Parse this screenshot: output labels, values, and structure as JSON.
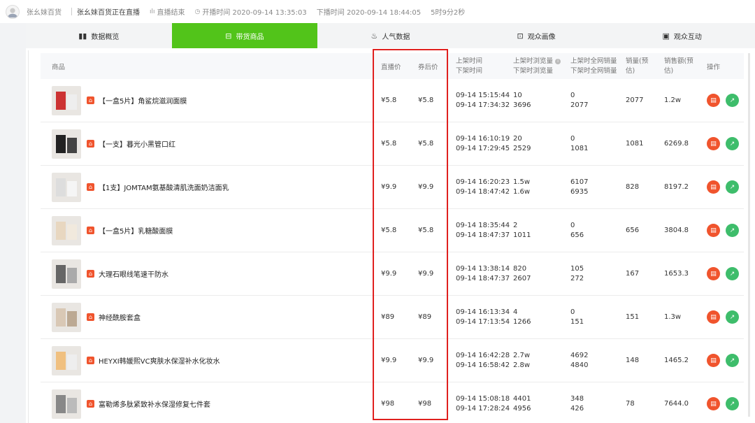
{
  "header": {
    "streamer_name": "张幺妹百货",
    "live_title": "张幺妹百货正在直播",
    "status": "直播结束",
    "start_label": "开播时间 2020-09-14 13:35:03",
    "end_label": "下播时间 2020-09-14 18:44:05",
    "duration": "5时9分2秒"
  },
  "tabs": [
    {
      "label": "数据概览",
      "icon": "bar-chart-icon"
    },
    {
      "label": "带货商品",
      "icon": "shopping-bag-icon",
      "active": true
    },
    {
      "label": "人气数据",
      "icon": "flame-icon"
    },
    {
      "label": "观众画像",
      "icon": "portrait-icon"
    },
    {
      "label": "观众互动",
      "icon": "chat-icon"
    }
  ],
  "table": {
    "headers": {
      "product": "商品",
      "live_price": "直播价",
      "coupon_price": "券后价",
      "time_on": "上架时间",
      "time_off": "下架时间",
      "views_on": "上架时浏览量",
      "views_off": "下架时浏览量",
      "sales_on": "上架时全网销量",
      "sales_off": "下架时全网销量",
      "volume_est_1": "销量(预",
      "volume_est_2": "估)",
      "amount_est_1": "销售额(预",
      "amount_est_2": "估)",
      "ops": "操作"
    },
    "rows": [
      {
        "name": "【一盒5片】角鲨烷滋润面膜",
        "live": "¥5.8",
        "coupon": "¥5.8",
        "on": "09-14 15:15:44",
        "off": "09-14 17:34:32",
        "v_on": "10",
        "v_off": "3696",
        "s_on": "0",
        "s_off": "2077",
        "vol": "2077",
        "amt": "1.2w"
      },
      {
        "name": "【一支】暮光小黑管口红",
        "live": "¥5.8",
        "coupon": "¥5.8",
        "on": "09-14 16:10:19",
        "off": "09-14 17:29:45",
        "v_on": "20",
        "v_off": "2529",
        "s_on": "0",
        "s_off": "1081",
        "vol": "1081",
        "amt": "6269.8"
      },
      {
        "name": "【1支】JOMTAM氨基酸清肌洗面奶洁面乳",
        "live": "¥9.9",
        "coupon": "¥9.9",
        "on": "09-14 16:20:23",
        "off": "09-14 18:47:42",
        "v_on": "1.5w",
        "v_off": "1.6w",
        "s_on": "6107",
        "s_off": "6935",
        "vol": "828",
        "amt": "8197.2"
      },
      {
        "name": "【一盒5片】乳糖酸面膜",
        "live": "¥5.8",
        "coupon": "¥5.8",
        "on": "09-14 18:35:44",
        "off": "09-14 18:47:37",
        "v_on": "2",
        "v_off": "1011",
        "s_on": "0",
        "s_off": "656",
        "vol": "656",
        "amt": "3804.8"
      },
      {
        "name": "大理石眼线笔速干防水",
        "live": "¥9.9",
        "coupon": "¥9.9",
        "on": "09-14 13:38:14",
        "off": "09-14 18:47:37",
        "v_on": "820",
        "v_off": "2607",
        "s_on": "105",
        "s_off": "272",
        "vol": "167",
        "amt": "1653.3"
      },
      {
        "name": "神经酰胺套盒",
        "live": "¥89",
        "coupon": "¥89",
        "on": "09-14 16:13:34",
        "off": "09-14 17:13:54",
        "v_on": "4",
        "v_off": "1266",
        "s_on": "0",
        "s_off": "151",
        "vol": "151",
        "amt": "1.3w"
      },
      {
        "name": "HEYXI韩媛熙VC爽肤水保湿补水化妆水",
        "live": "¥9.9",
        "coupon": "¥9.9",
        "on": "09-14 16:42:28",
        "off": "09-14 16:58:42",
        "v_on": "2.7w",
        "v_off": "2.8w",
        "s_on": "4692",
        "s_off": "4840",
        "vol": "148",
        "amt": "1465.2"
      },
      {
        "name": "富勒烯多肽紧致补水保湿修复七件套",
        "live": "¥98",
        "coupon": "¥98",
        "on": "09-14 15:08:18",
        "off": "09-14 17:28:24",
        "v_on": "4401",
        "v_off": "4956",
        "s_on": "348",
        "s_off": "426",
        "vol": "78",
        "amt": "7644.0"
      }
    ]
  }
}
